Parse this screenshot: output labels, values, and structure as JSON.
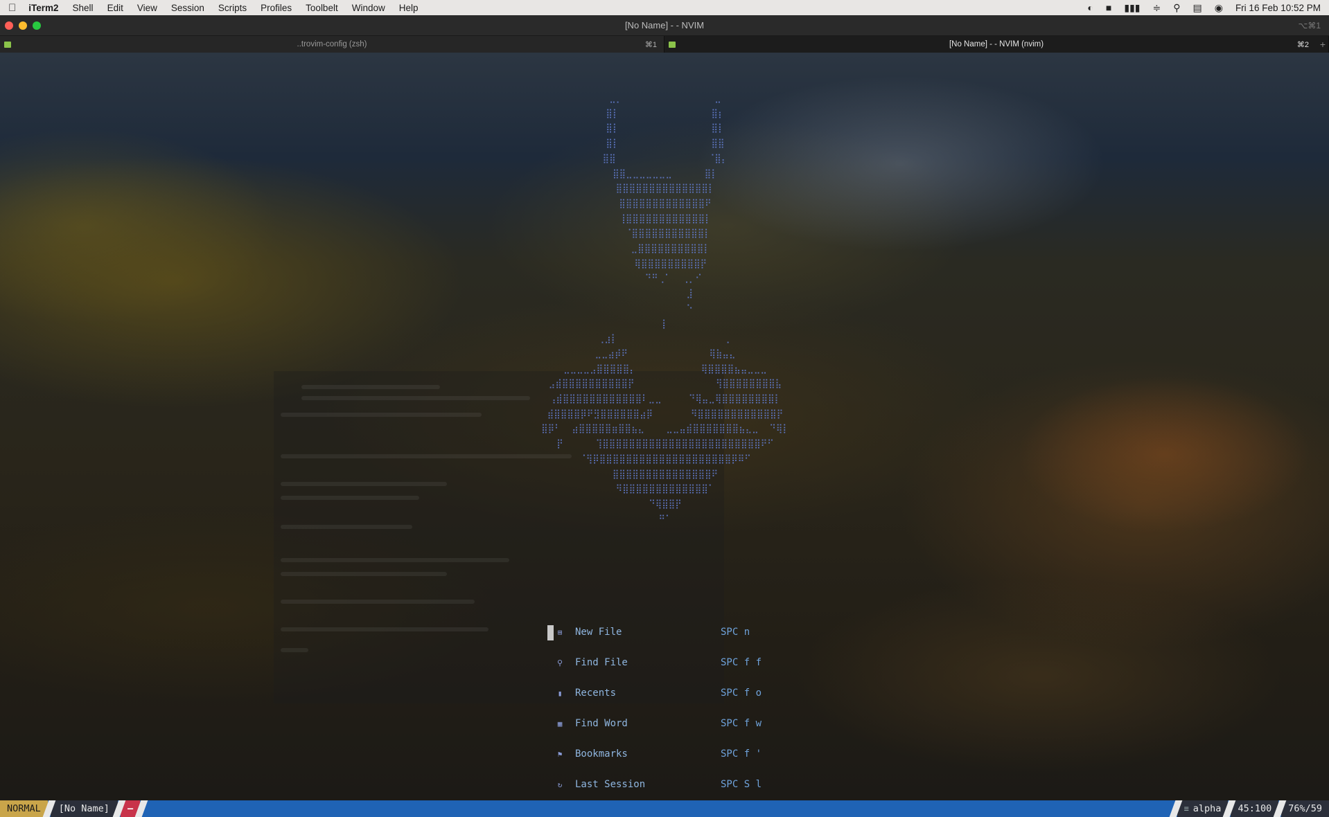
{
  "menubar": {
    "app": "iTerm2",
    "items": [
      "Shell",
      "Edit",
      "View",
      "Session",
      "Scripts",
      "Profiles",
      "Toolbelt",
      "Window",
      "Help"
    ],
    "datetime": "Fri 16 Feb  10:52 PM"
  },
  "window": {
    "title": "[No Name] - - NVIM",
    "shortcut": "⌥⌘1"
  },
  "tabs": [
    {
      "title": "..trovim-config (zsh)",
      "shortcut": "⌘1"
    },
    {
      "title": "[No Name] - - NVIM (nvim)",
      "shortcut": "⌘2"
    }
  ],
  "dashboard": {
    "items": [
      {
        "icon": "new-file-icon",
        "label": "New File",
        "key": "SPC n"
      },
      {
        "icon": "find-file-icon",
        "label": "Find File",
        "key": "SPC f f"
      },
      {
        "icon": "recents-icon",
        "label": "Recents",
        "key": "SPC f o"
      },
      {
        "icon": "find-word-icon",
        "label": "Find Word",
        "key": "SPC f w"
      },
      {
        "icon": "bookmark-icon",
        "label": "Bookmarks",
        "key": "SPC f '"
      },
      {
        "icon": "last-session-icon",
        "label": "Last Session",
        "key": "SPC S l"
      }
    ]
  },
  "statusline": {
    "mode": "NORMAL",
    "filename": "[No Name]",
    "modified": "–",
    "filetype": "alpha",
    "position": "45:100",
    "percent": "76%/59"
  },
  "colors": {
    "accent_blue": "#1f63b5",
    "mode_bg": "#c9a54a",
    "modified_bg": "#c8334a",
    "ascii_art": "#5f78c7"
  }
}
